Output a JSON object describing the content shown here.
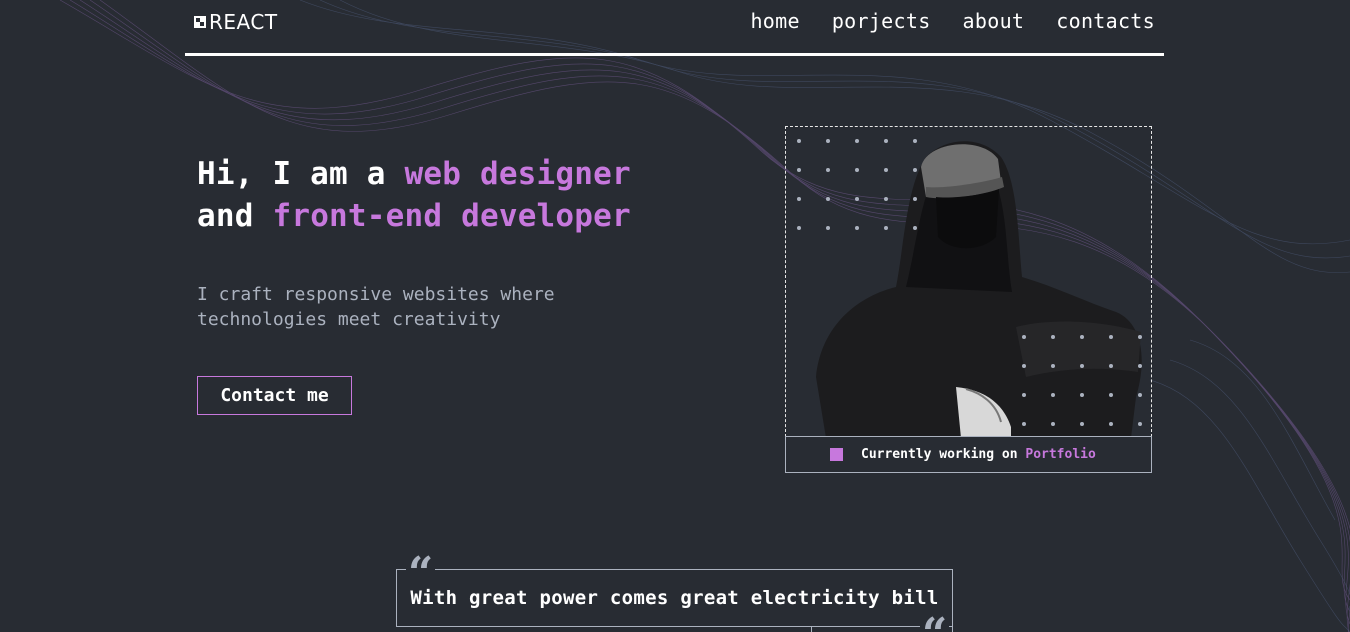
{
  "header": {
    "logo_text": "REACT",
    "nav": [
      {
        "label": "home"
      },
      {
        "label": "porjects"
      },
      {
        "label": "about"
      },
      {
        "label": "contacts"
      }
    ]
  },
  "hero": {
    "title_part1": "Hi, I am a ",
    "title_accent1": "web designer",
    "title_part2": "and ",
    "title_accent2": "front-end developer",
    "subtitle_line1": "I craft responsive websites where",
    "subtitle_line2": "technologies meet creativity",
    "cta_label": "Contact me"
  },
  "status": {
    "prefix": "Currently working on ",
    "project": "Portfolio"
  },
  "quote": {
    "text": "With great power comes great electricity bill",
    "open_mark": "“",
    "close_mark": "“"
  },
  "colors": {
    "background": "#282c33",
    "accent": "#c778dd",
    "text": "#ffffff",
    "muted": "#abb2bf"
  },
  "icons": {
    "logo": "logo-icon",
    "status_marker": "square-icon",
    "quote": "quote-icon"
  }
}
